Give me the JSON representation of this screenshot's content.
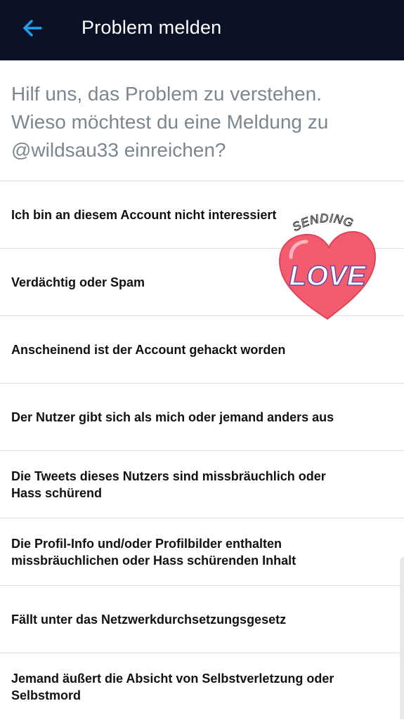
{
  "header": {
    "title": "Problem melden",
    "back_icon": "arrow-left-icon",
    "accent_color": "#1da1f2",
    "background_color": "#0b1126"
  },
  "question": {
    "line1": "Hilf uns, das Problem zu verstehen.",
    "line2": "Wieso möchtest du eine Meldung zu",
    "line3": "@wildsau33 einreichen?"
  },
  "options": [
    {
      "label": "Ich bin an diesem Account nicht interessiert"
    },
    {
      "label": "Verdächtig oder Spam"
    },
    {
      "label": "Anscheinend ist der Account gehackt worden"
    },
    {
      "label": "Der Nutzer gibt sich als mich oder jemand anders aus"
    },
    {
      "label": "Die Tweets dieses Nutzers sind missbräuchlich oder Hass schürend"
    },
    {
      "label": "Die Profil-Info und/oder Profilbilder enthalten missbräuchlichen oder Hass schürenden Inhalt"
    },
    {
      "label": "Fällt unter das Netzwerkdurchsetzungsgesetz"
    },
    {
      "label": "Jemand äußert die Absicht von Selbstverletzung oder Selbstmord"
    }
  ],
  "sticker": {
    "top_text": "SENDING",
    "main_text": "LOVE",
    "icon": "heart-icon",
    "heart_color": "#f25c6e"
  }
}
